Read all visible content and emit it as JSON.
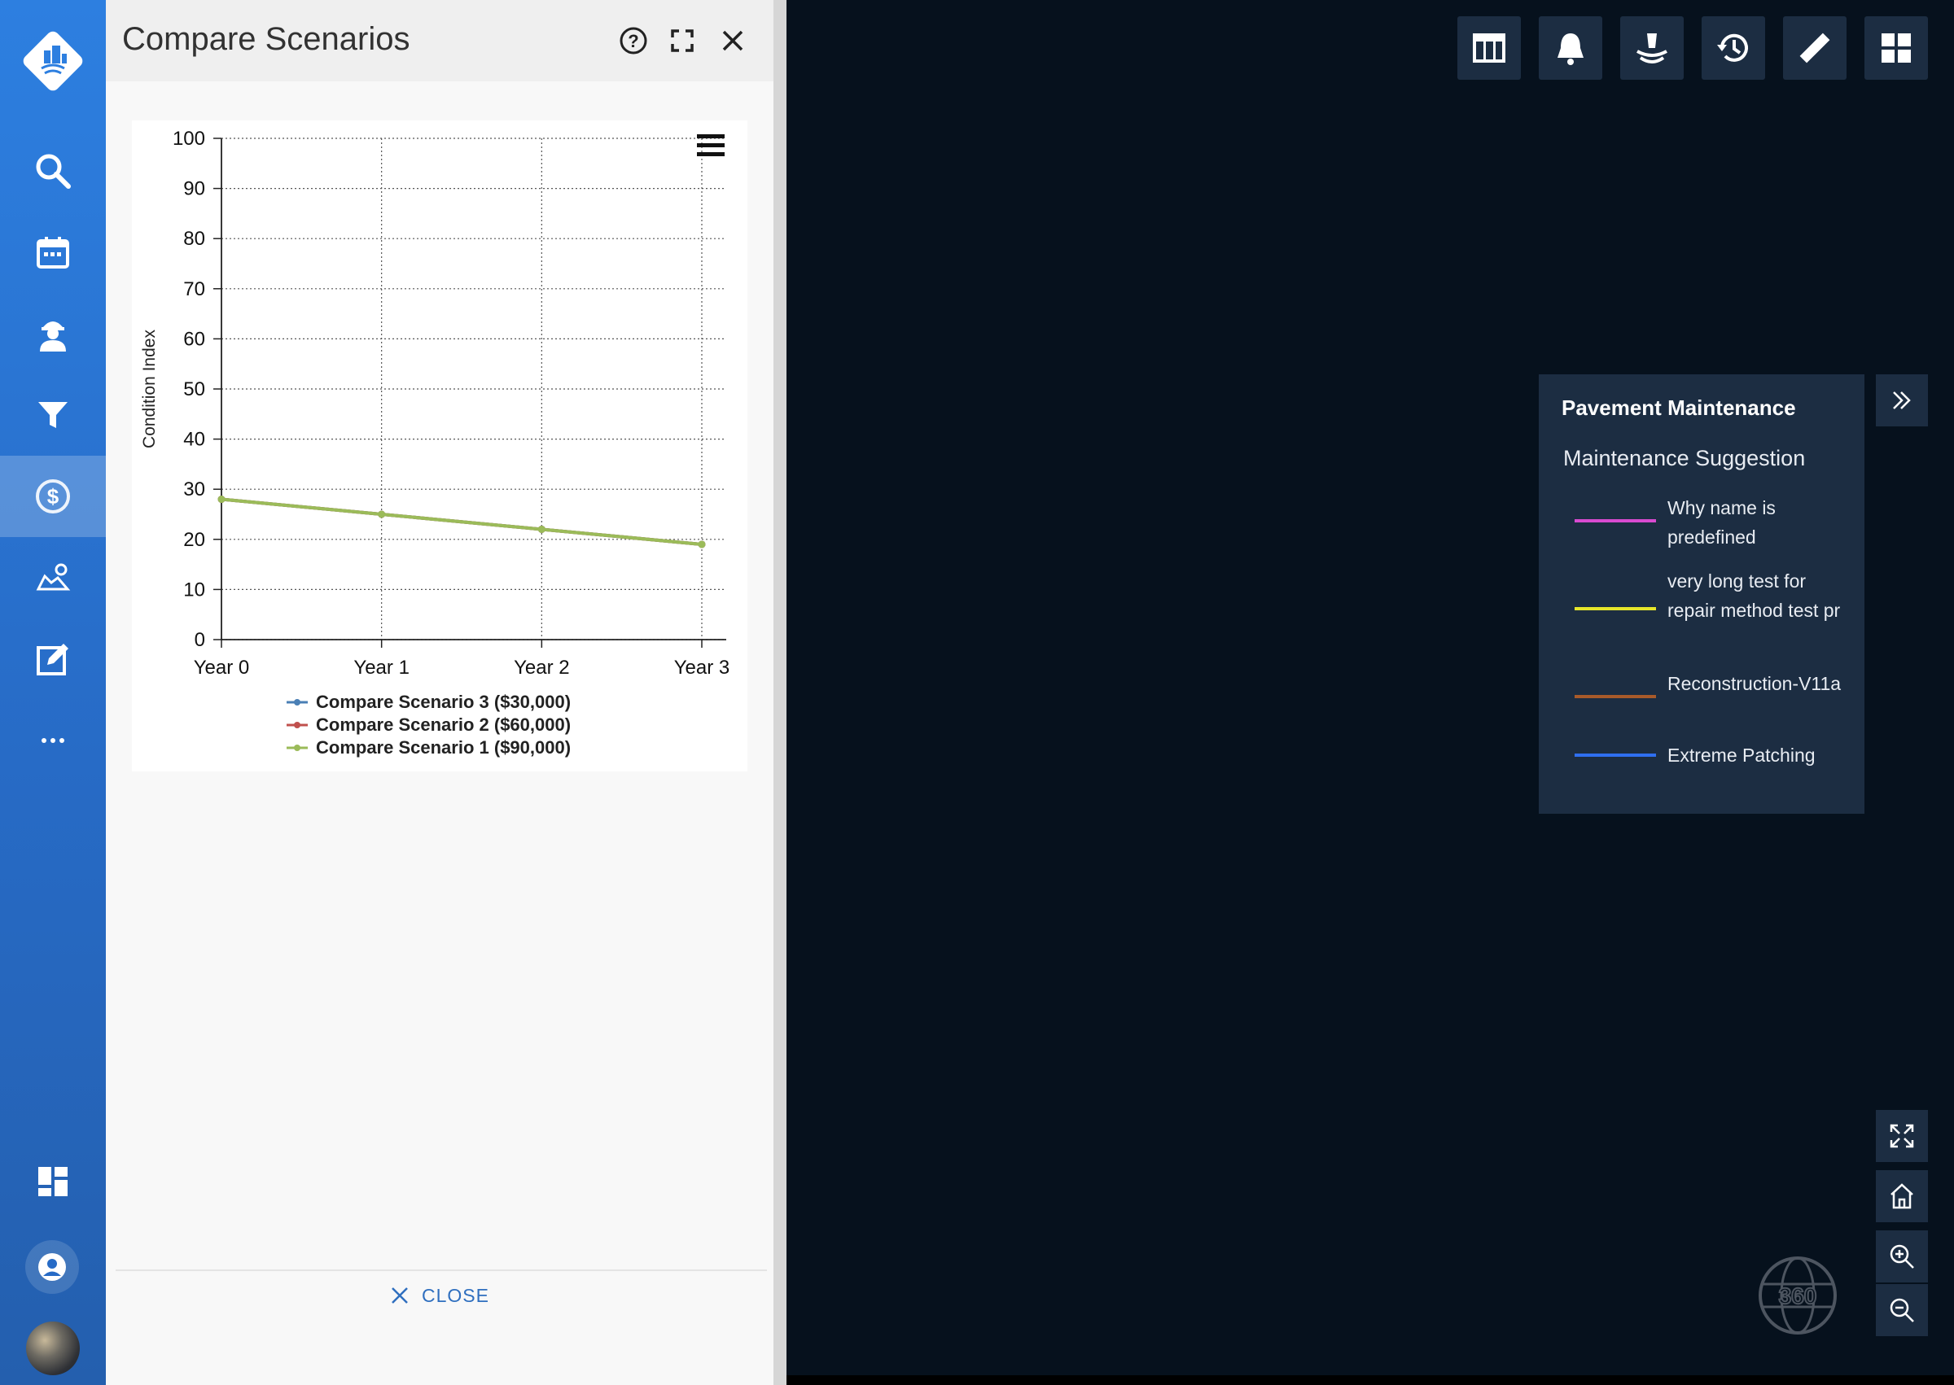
{
  "panel": {
    "title": "Compare Scenarios",
    "close_label": "CLOSE"
  },
  "nav": {
    "items": [
      "search-icon",
      "calendar-icon",
      "worker-icon",
      "filter-icon",
      "dollar-icon",
      "map-marker-icon",
      "edit-icon",
      "more-icon"
    ],
    "active": "dollar-icon"
  },
  "toolbar": {
    "tools": [
      "table-icon",
      "bell-icon",
      "layers-icon",
      "history-icon",
      "ruler-icon",
      "grid-icon"
    ]
  },
  "legend": {
    "title": "Pavement Maintenance",
    "subtitle": "Maintenance Suggestion",
    "items": [
      {
        "label": "Why name is predefined",
        "color": "#d84ad0"
      },
      {
        "label": "very long test for repair method test pr",
        "color": "#e6e62a"
      },
      {
        "label": "Reconstruction-V11a",
        "color": "#a85a2a"
      },
      {
        "label": "Extreme Patching",
        "color": "#2f6ff0"
      }
    ]
  },
  "map_controls": [
    "fullscreen-icon",
    "home-icon",
    "zoom-in-icon",
    "zoom-out-icon"
  ],
  "chart_data": {
    "type": "line",
    "categories": [
      "Year 0",
      "Year 1",
      "Year 2",
      "Year 3"
    ],
    "ylabel": "Condition Index",
    "xlabel": "",
    "ylim": [
      0,
      100
    ],
    "yticks": [
      0,
      10,
      20,
      30,
      40,
      50,
      60,
      70,
      80,
      90,
      100
    ],
    "grid": true,
    "series": [
      {
        "name": "Compare Scenario 3 ($30,000)",
        "color": "#4a7fb5",
        "values": [
          28,
          25,
          22,
          19
        ]
      },
      {
        "name": "Compare Scenario 2 ($60,000)",
        "color": "#c0504d",
        "values": [
          28,
          25,
          22,
          19
        ]
      },
      {
        "name": "Compare Scenario 1 ($90,000)",
        "color": "#9bbb59",
        "values": [
          28,
          25,
          22,
          19
        ]
      }
    ],
    "legend_position": "bottom"
  }
}
